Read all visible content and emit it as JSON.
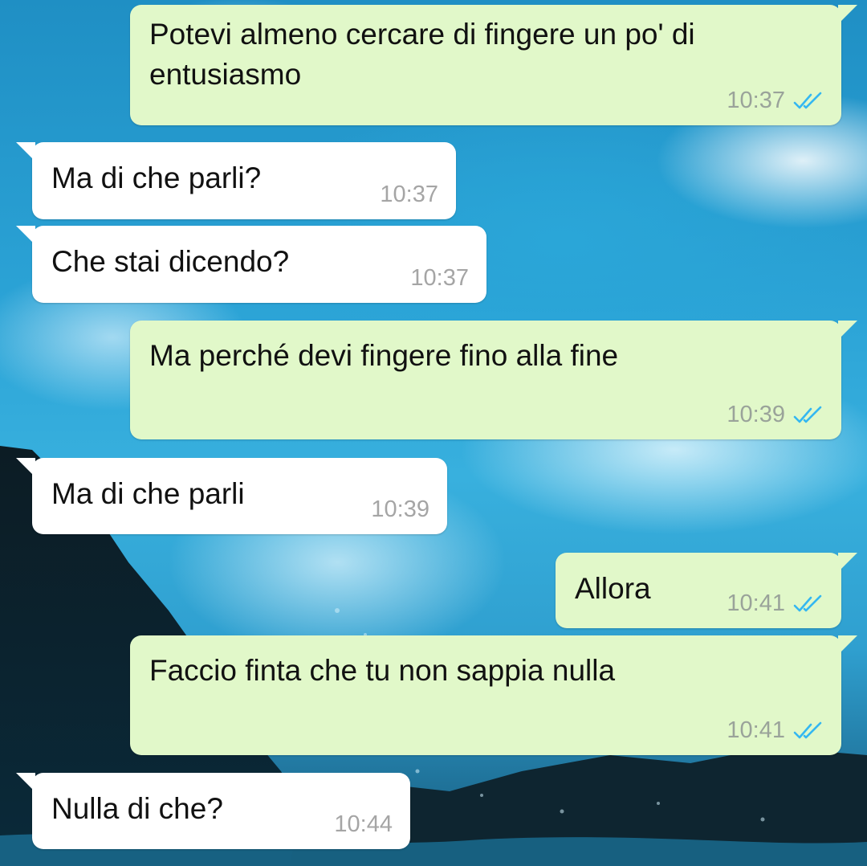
{
  "chat": {
    "messages": [
      {
        "direction": "outgoing",
        "text_lines": [
          "Potevi almeno cercare di fingere un po' di",
          "entusiasmo"
        ],
        "time": "10:37",
        "status": "read"
      },
      {
        "direction": "incoming",
        "text_lines": [
          "Ma di che parli?"
        ],
        "time": "10:37"
      },
      {
        "direction": "incoming",
        "text_lines": [
          "Che stai dicendo?"
        ],
        "time": "10:37"
      },
      {
        "direction": "outgoing",
        "text_lines": [
          "Ma perché devi fingere fino alla fine"
        ],
        "time": "10:39",
        "status": "read"
      },
      {
        "direction": "incoming",
        "text_lines": [
          "Ma di che parli"
        ],
        "time": "10:39"
      },
      {
        "direction": "outgoing",
        "text_lines": [
          "Allora"
        ],
        "time": "10:41",
        "status": "read"
      },
      {
        "direction": "outgoing",
        "text_lines": [
          "Faccio finta che tu non sappia nulla"
        ],
        "time": "10:41",
        "status": "read"
      },
      {
        "direction": "incoming",
        "text_lines": [
          "Nulla di che?"
        ],
        "time": "10:44"
      }
    ]
  },
  "colors": {
    "outgoing_bubble": "#e1f8c9",
    "incoming_bubble": "#ffffff",
    "read_ticks": "#34b7f1",
    "timestamp": "#9aa39a"
  },
  "icons": {
    "read_receipt": "double-check-icon"
  }
}
